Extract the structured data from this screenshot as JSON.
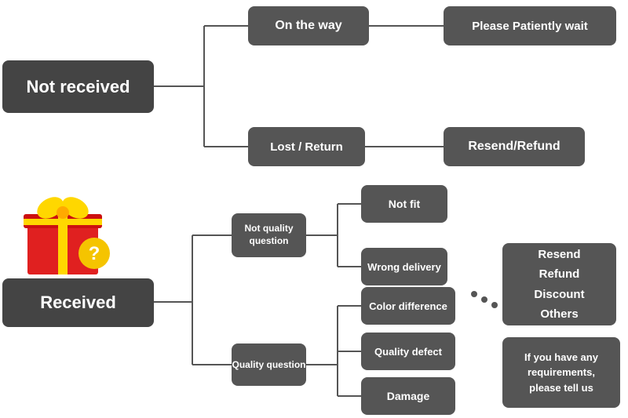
{
  "nodes": {
    "not_received": {
      "label": "Not received"
    },
    "on_the_way": {
      "label": "On the way"
    },
    "please_wait": {
      "label": "Please Patiently wait"
    },
    "lost_return": {
      "label": "Lost / Return"
    },
    "resend_refund_top": {
      "label": "Resend/Refund"
    },
    "received": {
      "label": "Received"
    },
    "not_quality": {
      "label": "Not quality\nquestion"
    },
    "quality_question": {
      "label": "Quality question"
    },
    "not_fit": {
      "label": "Not fit"
    },
    "wrong_delivery": {
      "label": "Wrong delivery"
    },
    "color_difference": {
      "label": "Color difference"
    },
    "quality_defect": {
      "label": "Quality defect"
    },
    "damage": {
      "label": "Damage"
    },
    "resend_options": {
      "label": "Resend\nRefund\nDiscount\nOthers"
    },
    "if_requirements": {
      "label": "If you have any\nrequirements,\nplease tell us"
    }
  }
}
